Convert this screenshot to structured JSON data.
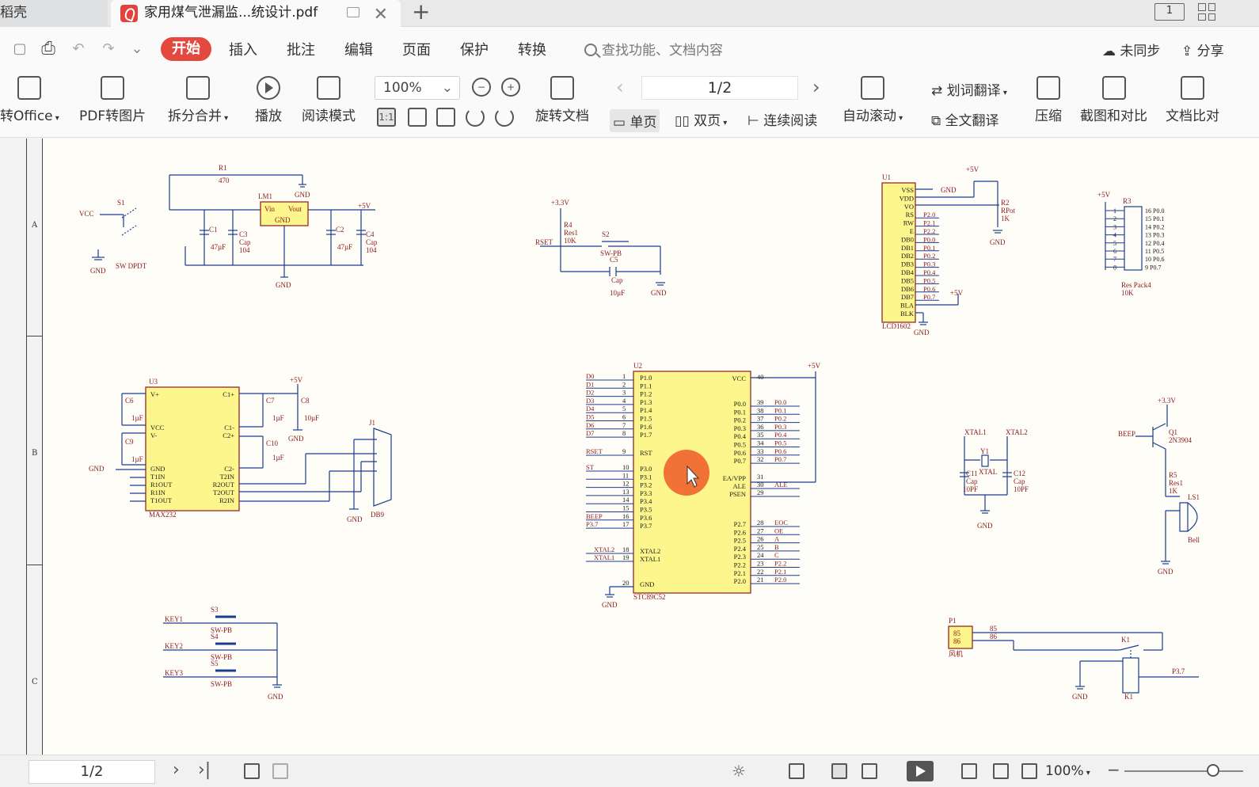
{
  "tabs": {
    "prev_label": "稻壳",
    "active_label": "家用煤气泄漏监...统设计.pdf",
    "add_label": "+"
  },
  "menu": {
    "start": "开始",
    "items": [
      "插入",
      "批注",
      "编辑",
      "页面",
      "保护",
      "转换"
    ],
    "search_placeholder": "查找功能、文档内容",
    "sync": "未同步",
    "share": "分享"
  },
  "toolbar": {
    "to_office": "转Office",
    "pdf_to_image": "PDF转图片",
    "split_merge": "拆分合并",
    "play": "播放",
    "read_mode": "阅读模式",
    "zoom": "100%",
    "rotate_doc": "旋转文档",
    "page_indicator": "1/2",
    "single_page": "单页",
    "double_page": "双页",
    "continuous": "连续阅读",
    "auto_scroll": "自动滚动",
    "word_translate": "划词翻译",
    "full_translate": "全文翻译",
    "compress": "压缩",
    "screenshot_compare": "截图和对比",
    "doc_compare": "文档比对",
    "one_to_one": "1:1"
  },
  "schematic": {
    "row_labels": [
      "A",
      "B",
      "C"
    ],
    "power": {
      "r1": "R1",
      "r1v": "470",
      "s1": "S1",
      "vcc": "VCC",
      "swdpdt": "SW DPDT",
      "lm1": "LM1",
      "vin": "Vin",
      "vout": "Vout",
      "gnd": "GND",
      "p5v": "+5V",
      "c1": "C1",
      "c1v": "47µF",
      "c3": "C3",
      "cap": "Cap",
      "c3v": "104",
      "c2": "C2",
      "c2v": "47µF",
      "c4": "C4",
      "c4v": "104"
    },
    "reset": {
      "p33v": "+3.3V",
      "r4": "R4",
      "res1": "Res1",
      "r4v": "10K",
      "rset": "RSET",
      "s2": "S2",
      "swpb": "SW-PB",
      "c5": "C5",
      "cap": "Cap",
      "c5v": "10µF",
      "gnd": "GND"
    },
    "lcd": {
      "u1": "U1",
      "pins": [
        "VSS",
        "VDD",
        "VO",
        "RS",
        "RW",
        "E",
        "DB0",
        "DB1",
        "DB2",
        "DB3",
        "DB4",
        "DB5",
        "DB6",
        "DB7",
        "BLA",
        "BLK"
      ],
      "nets": [
        "",
        "",
        "",
        "P2.0",
        "P2.1",
        "P2.2",
        "P0.0",
        "P0.1",
        "P0.2",
        "P0.3",
        "P0.4",
        "P0.5",
        "P0.6",
        "P0.7",
        "",
        ""
      ],
      "name": "LCD1602",
      "gnd": "GND",
      "p5v": "+5V",
      "r2": "R2",
      "rpot": "RPot",
      "r2v": "1K"
    },
    "respack": {
      "p5v": "+5V",
      "r3": "R3",
      "left": [
        "1",
        "2",
        "3",
        "4",
        "5",
        "6",
        "7",
        "8"
      ],
      "right": [
        "16 P0.0",
        "15 P0.1",
        "14 P0.2",
        "13 P0.3",
        "12 P0.4",
        "11 P0.5",
        "10 P0.6",
        "9  P0.7"
      ],
      "name": "Res Pack4",
      "value": "10K"
    },
    "max232": {
      "u3": "U3",
      "name": "MAX232",
      "left": [
        "V+",
        "VCC",
        "V-",
        "GND",
        "T1IN",
        "R1OUT",
        "R1IN",
        "T1OUT"
      ],
      "right": [
        "C1+",
        "C1-",
        "C2+",
        "C2-",
        "T2IN",
        "R2OUT",
        "T2OUT",
        "R2IN"
      ],
      "c6": "C6",
      "c9": "C9",
      "c7": "C7",
      "c8": "C8",
      "c10": "C10",
      "uf": "1µF",
      "c8v": "10µF",
      "p5v": "+5V",
      "gnd": "GND",
      "j1": "J1",
      "db9": "DB9"
    },
    "mcu": {
      "u2": "U2",
      "name": "STC89C52",
      "left_pins": [
        "P1.0",
        "P1.1",
        "P1.2",
        "P1.3",
        "P1.4",
        "P1.5",
        "P1.6",
        "P1.7",
        "RST",
        "P3.0",
        "P3.1",
        "P3.2",
        "P3.3",
        "P3.4",
        "P3.5",
        "P3.6",
        "P3.7",
        "XTAL2",
        "XTAL1",
        "GND"
      ],
      "left_nets": [
        "D0",
        "D1",
        "D2",
        "D3",
        "D4",
        "D5",
        "D6",
        "D7",
        "RSET",
        "ST",
        "",
        "",
        "",
        "",
        "",
        "BEEP",
        "P3.7",
        "XTAL2",
        "XTAL1",
        ""
      ],
      "left_nums": [
        "1",
        "2",
        "3",
        "4",
        "5",
        "6",
        "7",
        "8",
        "9",
        "10",
        "11",
        "12",
        "13",
        "14",
        "15",
        "16",
        "17",
        "18",
        "19",
        "20"
      ],
      "right_pins": [
        "VCC",
        "P0.0",
        "P0.1",
        "P0.2",
        "P0.3",
        "P0.4",
        "P0.5",
        "P0.6",
        "P0.7",
        "EA/VPP",
        "ALE",
        "PSEN",
        "P2.7",
        "P2.6",
        "P2.5",
        "P2.4",
        "P2.3",
        "P2.2",
        "P2.1",
        "P2.0"
      ],
      "right_nums": [
        "40",
        "39",
        "38",
        "37",
        "36",
        "35",
        "34",
        "33",
        "32",
        "31",
        "30",
        "29",
        "28",
        "27",
        "26",
        "25",
        "24",
        "23",
        "22",
        "21"
      ],
      "right_nets": [
        "",
        "P0.0",
        "P0.1",
        "P0.2",
        "P0.3",
        "P0.4",
        "P0.5",
        "P0.6",
        "P0.7",
        "",
        "ALE",
        "",
        "EOC",
        "OE",
        "A",
        "B",
        "C",
        "P2.2",
        "P2.1",
        "P2.0"
      ],
      "p5v": "+5V",
      "gnd": "GND"
    },
    "xtal": {
      "xtal1": "XTAL1",
      "xtal2": "XTAL2",
      "y1": "Y1",
      "xt": "XTAL",
      "c11": "C11",
      "c12": "C12",
      "cap": "Cap",
      "pf": "10PF",
      "gnd": "GND"
    },
    "beep": {
      "p33v": "+3.3V",
      "q1": "Q1",
      "q1v": "2N3904",
      "beep": "BEEP",
      "r5": "R5",
      "res1": "Res1",
      "r5v": "1K",
      "ls1": "LS1",
      "bell": "Bell",
      "gnd": "GND"
    },
    "keys": {
      "labels": [
        "KEY1",
        "KEY2",
        "KEY3"
      ],
      "refs": [
        "S3",
        "S4",
        "S5"
      ],
      "swpb": "SW-PB",
      "gnd": "GND"
    },
    "fan": {
      "p1": "P1",
      "n85": "85",
      "n86": "86",
      "fan": "风机",
      "k1": "K1",
      "p37": "P3.7",
      "gnd": "GND"
    }
  },
  "status": {
    "page": "1/2",
    "zoom": "100%"
  },
  "colors": {
    "start_button": "#e4493f",
    "component_fill": "#fdf68c",
    "net_red": "#8b1a1a",
    "pointer_highlight": "#f0642e"
  }
}
